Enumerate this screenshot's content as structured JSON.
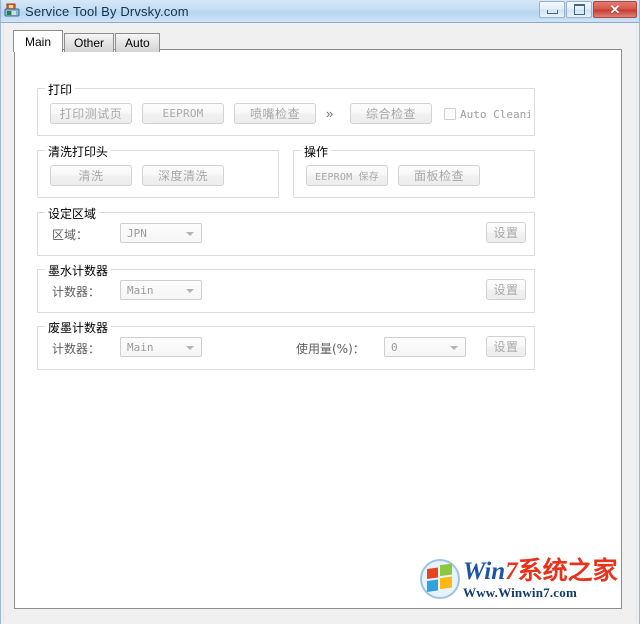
{
  "window": {
    "title": "Service Tool By Drvsky.com",
    "icon": "printer-icon",
    "caption": {
      "minimize_label": "–",
      "maximize_label": "□",
      "close_label": "✕"
    }
  },
  "tabs": [
    {
      "label": "Main",
      "selected": true
    },
    {
      "label": "Other",
      "selected": false
    },
    {
      "label": "Auto",
      "selected": false
    }
  ],
  "groups": {
    "print": {
      "title": "打印",
      "buttons": [
        {
          "label": "打印测试页"
        },
        {
          "label": "EEPROM"
        },
        {
          "label": "喷嘴检查"
        },
        {
          "label": "综合检查"
        }
      ],
      "arrows": "»",
      "checkbox": {
        "label": "Auto Cleani",
        "checked": false
      }
    },
    "clean": {
      "title": "清洗打印头",
      "buttons": [
        {
          "label": "清洗"
        },
        {
          "label": "深度清洗"
        }
      ]
    },
    "operation": {
      "title": "操作",
      "buttons": [
        {
          "label": "EEPROM 保存"
        },
        {
          "label": "面板检查"
        }
      ]
    },
    "region": {
      "title": "设定区域",
      "field_label": "区域：",
      "combo_value": "JPN",
      "set_button": "设置"
    },
    "ink_counter": {
      "title": "墨水计数器",
      "field_label": "计数器：",
      "combo_value": "Main",
      "set_button": "设置"
    },
    "waste_counter": {
      "title": "废墨计数器",
      "field_label": "计数器：",
      "combo_value": "Main",
      "usage_label": "使用量(%)：",
      "usage_value": "0",
      "set_button": "设置"
    }
  },
  "watermark": {
    "win": "Win",
    "seven": "7",
    "cjk": "系统之家",
    "url": "Www.Winwin7.com"
  },
  "colors": {
    "titlebar": "#c3ddf3",
    "close_button": "#c33b2f",
    "group_border": "#dcdcdc",
    "disabled_text": "#a8a8a8",
    "watermark_blue": "#1c53a8",
    "watermark_red": "#e8331c"
  }
}
